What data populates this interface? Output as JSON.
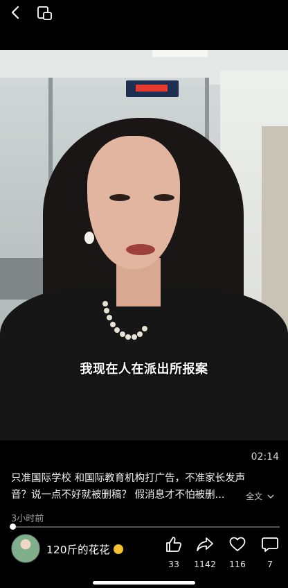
{
  "video": {
    "subtitle": "我现在人在派出所报案",
    "duration": "02:14",
    "progress_percent": 0.5
  },
  "description": {
    "line1": "只准国际学校 和国际教育机构打广告，不准家长发声",
    "line2": "音？说一点不好就被删稿？ 假消息才不怕被删...",
    "expand_label": "全文"
  },
  "meta": {
    "time_ago": "3小时前"
  },
  "author": {
    "name": "120斤的花花"
  },
  "actions": {
    "like_count": "33",
    "share_count": "1142",
    "favorite_count": "116",
    "comment_count": "7"
  },
  "colors": {
    "background": "#000000",
    "badge": "#f2c230"
  },
  "icons": {
    "back": "chevron-left-icon",
    "pip": "picture-in-picture-icon",
    "like": "thumbs-up-icon",
    "share": "share-arrow-icon",
    "favorite": "heart-icon",
    "comment": "comment-bubble-icon",
    "expand": "chevron-down-icon"
  }
}
